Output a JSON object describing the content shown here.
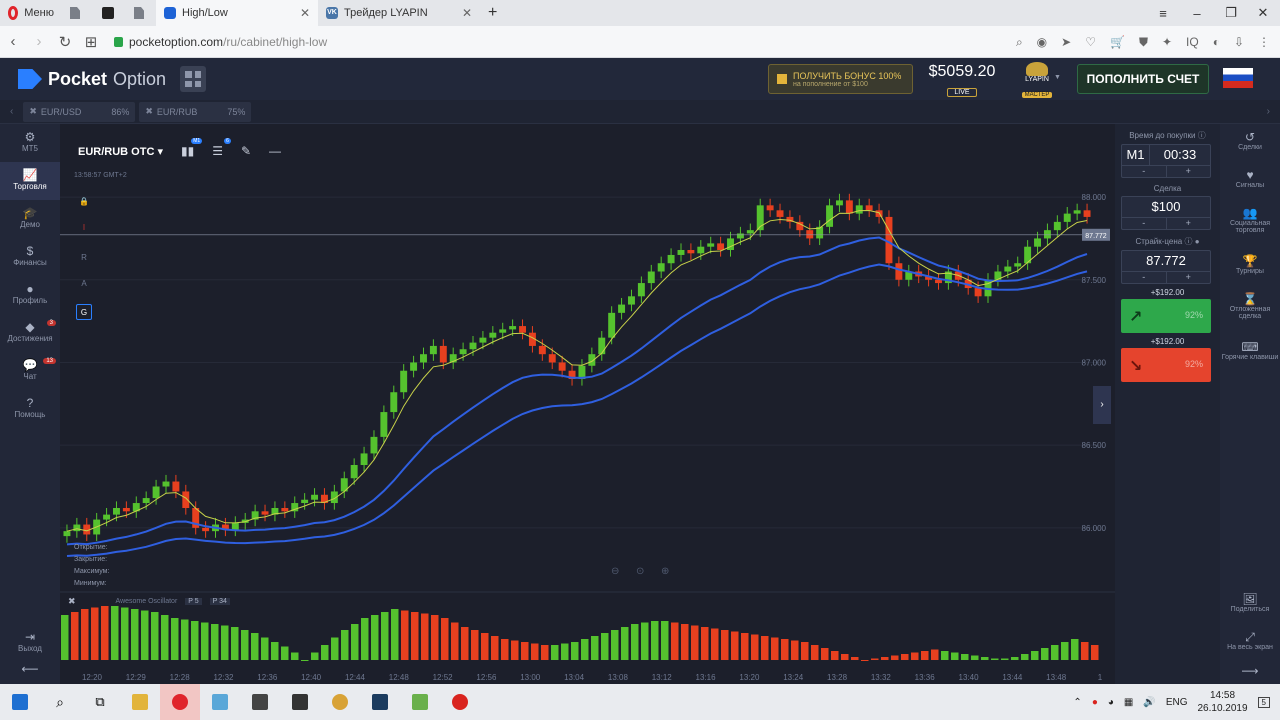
{
  "browser": {
    "tabs": [
      {
        "label": "Меню"
      },
      {
        "label": ""
      },
      {
        "label": ""
      },
      {
        "label": ""
      },
      {
        "label": "High/Low",
        "active": true
      },
      {
        "label": "Трейдер LYAPIN"
      }
    ],
    "url_host": "pocketoption.com",
    "url_path": "/ru/cabinet/high-low"
  },
  "header": {
    "logo_bold": "Pocket",
    "logo_thin": "Option",
    "bonus_line1": "ПОЛУЧИТЬ БОНУС 100%",
    "bonus_line2": "на пополнение от $100",
    "balance": "$5059.20",
    "account_type": "LIVE",
    "username": "LYAPIN",
    "rank": "МАСТЕР",
    "deposit_label": "ПОПОЛНИТЬ СЧЕТ"
  },
  "asset_tabs": [
    {
      "name": "EUR/USD",
      "payout": "86%"
    },
    {
      "name": "EUR/RUB",
      "payout": "75%"
    }
  ],
  "left_nav": [
    {
      "label": "MT5",
      "icon": "robot-icon"
    },
    {
      "label": "Торговля",
      "icon": "chart-icon",
      "active": true
    },
    {
      "label": "Демо",
      "icon": "graduation-icon"
    },
    {
      "label": "Финансы",
      "icon": "dollar-icon"
    },
    {
      "label": "Профиль",
      "icon": "user-icon"
    },
    {
      "label": "Достижения",
      "icon": "diamond-icon",
      "badge": "3"
    },
    {
      "label": "Чат",
      "icon": "chat-icon",
      "badge": "13"
    },
    {
      "label": "Помощь",
      "icon": "help-icon"
    }
  ],
  "left_bottom": {
    "label": "Выход"
  },
  "right_nav": [
    {
      "label": "Сделки",
      "icon": "history-icon"
    },
    {
      "label": "Сигналы",
      "icon": "signal-icon"
    },
    {
      "label": "Социальная торговля",
      "icon": "social-icon"
    },
    {
      "label": "Турниры",
      "icon": "trophy-icon"
    },
    {
      "label": "Отложенная сделка",
      "icon": "hourglass-icon"
    },
    {
      "label": "Горячие клавиши",
      "icon": "keyboard-icon"
    }
  ],
  "right_bottom": [
    {
      "label": "Поделиться"
    },
    {
      "label": "На весь экран"
    }
  ],
  "trade": {
    "time_label": "Время до покупки",
    "timeframe": "M1",
    "time": "00:33",
    "amount_label": "Сделка",
    "amount": "$100",
    "strike_label": "Страйк-цена",
    "strike": "87.772",
    "up_payout": "+$192.00",
    "up_pct": "92%",
    "down_payout": "+$192.00",
    "down_pct": "92%",
    "minus": "-",
    "plus": "+"
  },
  "chart": {
    "pair": "EUR/RUB OTC",
    "time_zone": "13:58:57 GMT+2",
    "tool_badge1": "M1",
    "tool_badge2": "6",
    "ohlc": [
      "Открытие:",
      "Закрытие:",
      "Максимум:",
      "Минимум:"
    ],
    "vtools": [
      "I",
      "R",
      "A",
      "G"
    ],
    "oscillator": "Awesome Oscillator",
    "osc_p1": "P 5",
    "osc_p2": "P 34"
  },
  "chart_data": {
    "type": "candlestick",
    "y_ticks": [
      "88.000",
      "87.500",
      "87.000",
      "86.500",
      "86.000"
    ],
    "price_tag": "87.772",
    "x_ticks": [
      "12:20",
      "12:29",
      "12:28",
      "12:32",
      "12:36",
      "12:40",
      "12:44",
      "12:48",
      "12:52",
      "12:56",
      "13:00",
      "13:04",
      "13:08",
      "13:12",
      "13:16",
      "13:20",
      "13:24",
      "13:28",
      "13:32",
      "13:36",
      "13:40",
      "13:44",
      "13:48",
      "1"
    ],
    "ylim": [
      85.6,
      88.2
    ],
    "closes": [
      85.98,
      86.02,
      85.96,
      86.05,
      86.08,
      86.12,
      86.1,
      86.15,
      86.18,
      86.25,
      86.28,
      86.22,
      86.12,
      86.0,
      85.98,
      86.02,
      85.99,
      86.03,
      86.05,
      86.1,
      86.08,
      86.12,
      86.1,
      86.15,
      86.17,
      86.2,
      86.15,
      86.22,
      86.3,
      86.38,
      86.45,
      86.55,
      86.7,
      86.82,
      86.95,
      87.0,
      87.05,
      87.1,
      87.0,
      87.05,
      87.08,
      87.12,
      87.15,
      87.18,
      87.2,
      87.22,
      87.18,
      87.1,
      87.05,
      87.0,
      86.95,
      86.9,
      86.98,
      87.05,
      87.15,
      87.3,
      87.35,
      87.4,
      87.48,
      87.55,
      87.6,
      87.65,
      87.68,
      87.66,
      87.7,
      87.72,
      87.68,
      87.75,
      87.78,
      87.8,
      87.95,
      87.92,
      87.88,
      87.85,
      87.8,
      87.75,
      87.82,
      87.95,
      87.98,
      87.9,
      87.95,
      87.92,
      87.88,
      87.6,
      87.5,
      87.55,
      87.52,
      87.5,
      87.48,
      87.55,
      87.5,
      87.45,
      87.4,
      87.5,
      87.55,
      87.58,
      87.6,
      87.7,
      87.75,
      87.8,
      87.85,
      87.9,
      87.92,
      87.88
    ],
    "oscillator": [
      -0.3,
      -0.32,
      -0.34,
      -0.35,
      -0.36,
      -0.36,
      -0.35,
      -0.34,
      -0.33,
      -0.32,
      -0.3,
      -0.28,
      -0.27,
      -0.26,
      -0.25,
      -0.24,
      -0.23,
      -0.22,
      -0.2,
      -0.18,
      -0.15,
      -0.12,
      -0.09,
      -0.05,
      0.0,
      0.05,
      0.1,
      0.15,
      0.2,
      0.24,
      0.28,
      0.3,
      0.32,
      0.34,
      0.33,
      0.32,
      0.31,
      0.3,
      0.28,
      0.25,
      0.22,
      0.2,
      0.18,
      0.16,
      0.14,
      0.13,
      0.12,
      0.11,
      0.1,
      0.1,
      0.11,
      0.12,
      0.14,
      0.16,
      0.18,
      0.2,
      0.22,
      0.24,
      0.25,
      0.26,
      0.26,
      0.25,
      0.24,
      0.23,
      0.22,
      0.21,
      0.2,
      0.19,
      0.18,
      0.17,
      0.16,
      0.15,
      0.14,
      0.13,
      0.12,
      0.1,
      0.08,
      0.06,
      0.04,
      0.02,
      0.0,
      -0.01,
      -0.02,
      -0.03,
      -0.04,
      -0.05,
      -0.06,
      -0.07,
      -0.06,
      -0.05,
      -0.04,
      -0.03,
      -0.02,
      -0.01,
      0.01,
      0.02,
      0.04,
      0.06,
      0.08,
      0.1,
      0.12,
      0.14,
      0.12,
      0.1
    ]
  },
  "taskbar": {
    "lang": "ENG",
    "time": "14:58",
    "date": "26.10.2019",
    "notif": "5"
  },
  "colors": {
    "up": "#55c22e",
    "down": "#e8401f",
    "ema_yellow": "#c8d24a",
    "ema_blue": "#2f5fe0"
  }
}
